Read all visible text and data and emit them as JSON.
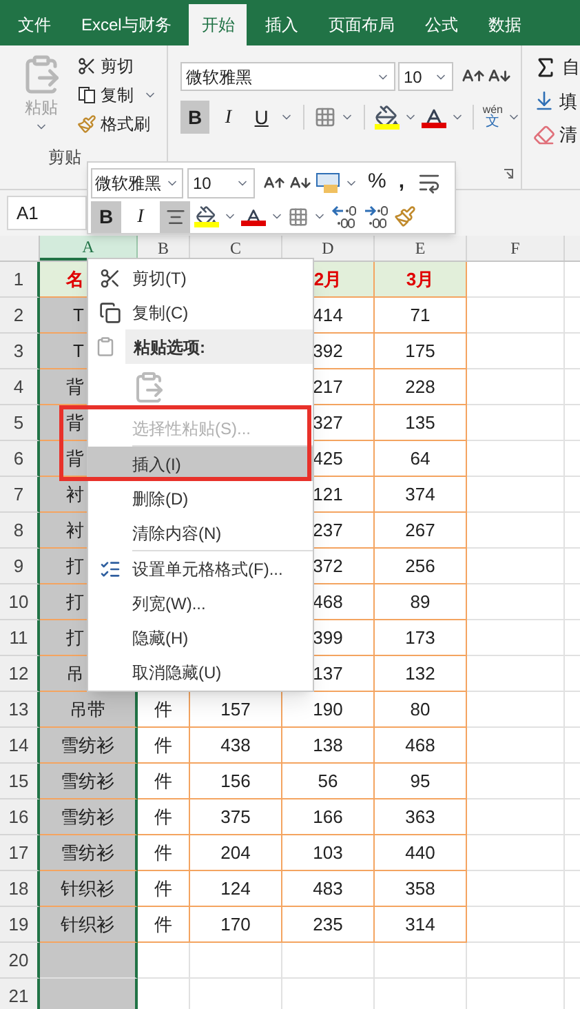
{
  "tabs": [
    {
      "label": "文件",
      "selected": false
    },
    {
      "label": "Excel与财务",
      "selected": false
    },
    {
      "label": "开始",
      "selected": true
    },
    {
      "label": "插入",
      "selected": false
    },
    {
      "label": "页面布局",
      "selected": false
    },
    {
      "label": "公式",
      "selected": false
    },
    {
      "label": "数据",
      "selected": false
    }
  ],
  "ribbon": {
    "clipboard": {
      "paste": "粘贴",
      "cut": "剪切",
      "copy": "复制",
      "format_painter": "格式刷",
      "group_label": "剪贴"
    },
    "font": {
      "font_name": "微软雅黑",
      "font_size": "10",
      "styles": [
        {
          "label": "B",
          "selected": true
        },
        {
          "label": "I",
          "selected": false
        },
        {
          "label": "U",
          "selected": false
        }
      ],
      "phonetic_top": "wén",
      "phonetic_bottom": "文"
    },
    "editing": [
      "自",
      "填",
      "清"
    ]
  },
  "mini_toolbar": {
    "font_name": "微软雅黑",
    "font_size": "10",
    "percent": "%",
    "comma": ",",
    "buttons": [
      {
        "kind": "bold",
        "label": "B",
        "selected": true
      },
      {
        "kind": "italic",
        "label": "I",
        "selected": false
      },
      {
        "kind": "align",
        "selected": true
      }
    ]
  },
  "name_box": "A1",
  "sheet": {
    "columns": [
      {
        "label": "A",
        "selected": true
      },
      {
        "label": "B",
        "selected": false
      },
      {
        "label": "C",
        "selected": false
      },
      {
        "label": "D",
        "selected": false
      },
      {
        "label": "E",
        "selected": false
      },
      {
        "label": "F",
        "selected": false
      }
    ],
    "rows": [
      {
        "number": "1",
        "kind": "header",
        "covered": true,
        "cells": [
          "名",
          null,
          null,
          "2月",
          "3月"
        ]
      },
      {
        "number": "2",
        "kind": "data",
        "covered": true,
        "cells": [
          "T",
          null,
          null,
          "414",
          "71"
        ]
      },
      {
        "number": "3",
        "kind": "data",
        "covered": true,
        "cells": [
          "T",
          null,
          null,
          "392",
          "175"
        ]
      },
      {
        "number": "4",
        "kind": "data",
        "covered": true,
        "cells": [
          "背",
          null,
          null,
          "217",
          "228"
        ]
      },
      {
        "number": "5",
        "kind": "data",
        "covered": true,
        "cells": [
          "背",
          null,
          null,
          "327",
          "135"
        ]
      },
      {
        "number": "6",
        "kind": "data",
        "covered": true,
        "cells": [
          "背",
          null,
          null,
          "425",
          "64"
        ]
      },
      {
        "number": "7",
        "kind": "data",
        "covered": true,
        "cells": [
          "衬",
          null,
          null,
          "121",
          "374"
        ]
      },
      {
        "number": "8",
        "kind": "data",
        "covered": true,
        "cells": [
          "衬",
          null,
          null,
          "237",
          "267"
        ]
      },
      {
        "number": "9",
        "kind": "data",
        "covered": true,
        "cells": [
          "打",
          null,
          null,
          "372",
          "256"
        ]
      },
      {
        "number": "10",
        "kind": "data",
        "covered": true,
        "cells": [
          "打",
          null,
          null,
          "468",
          "89"
        ]
      },
      {
        "number": "11",
        "kind": "data",
        "covered": true,
        "cells": [
          "打",
          null,
          null,
          "399",
          "173"
        ]
      },
      {
        "number": "12",
        "kind": "data",
        "covered": true,
        "cells": [
          "吊",
          null,
          null,
          "137",
          "132"
        ]
      },
      {
        "number": "13",
        "kind": "data",
        "covered": false,
        "cells": [
          "吊带",
          "件",
          "157",
          "190",
          "80"
        ]
      },
      {
        "number": "14",
        "kind": "data",
        "covered": false,
        "cells": [
          "雪纺衫",
          "件",
          "438",
          "138",
          "468"
        ]
      },
      {
        "number": "15",
        "kind": "data",
        "covered": false,
        "cells": [
          "雪纺衫",
          "件",
          "156",
          "56",
          "95"
        ]
      },
      {
        "number": "16",
        "kind": "data",
        "covered": false,
        "cells": [
          "雪纺衫",
          "件",
          "375",
          "166",
          "363"
        ]
      },
      {
        "number": "17",
        "kind": "data",
        "covered": false,
        "cells": [
          "雪纺衫",
          "件",
          "204",
          "103",
          "440"
        ]
      },
      {
        "number": "18",
        "kind": "data",
        "covered": false,
        "cells": [
          "针织衫",
          "件",
          "124",
          "483",
          "358"
        ]
      },
      {
        "number": "19",
        "kind": "data",
        "covered": false,
        "cells": [
          "针织衫",
          "件",
          "170",
          "235",
          "314"
        ]
      },
      {
        "number": "20",
        "kind": "empty"
      },
      {
        "number": "21",
        "kind": "empty"
      }
    ]
  },
  "context_menu": {
    "items": [
      {
        "kind": "cut",
        "label": "剪切(T)",
        "selected": false,
        "disabled": false
      },
      {
        "kind": "copy",
        "label": "复制(C)",
        "selected": false,
        "disabled": false
      },
      {
        "kind": "section",
        "label": "粘贴选项:"
      },
      {
        "kind": "paste_icon"
      },
      {
        "kind": "item",
        "label": "选择性粘贴(S)...",
        "selected": false,
        "disabled": true
      },
      {
        "kind": "separator"
      },
      {
        "kind": "item",
        "label": "插入(I)",
        "selected": true,
        "disabled": false
      },
      {
        "kind": "item",
        "label": "删除(D)",
        "selected": false,
        "disabled": false
      },
      {
        "kind": "item",
        "label": "清除内容(N)",
        "selected": false,
        "disabled": false
      },
      {
        "kind": "separator"
      },
      {
        "kind": "format",
        "label": "设置单元格格式(F)...",
        "selected": false,
        "disabled": false
      },
      {
        "kind": "item",
        "label": "列宽(W)...",
        "selected": false,
        "disabled": false
      },
      {
        "kind": "item",
        "label": "隐藏(H)",
        "selected": false,
        "disabled": false
      },
      {
        "kind": "item",
        "label": "取消隐藏(U)",
        "selected": false,
        "disabled": false
      }
    ]
  }
}
